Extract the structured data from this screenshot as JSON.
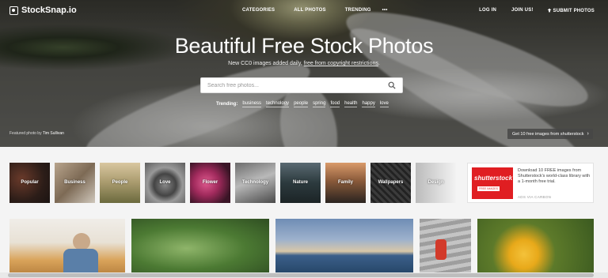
{
  "brand": {
    "name": "StockSnap.io"
  },
  "nav": {
    "center": [
      "CATEGORIES",
      "ALL PHOTOS",
      "TRENDING",
      "•••"
    ],
    "right": [
      "LOG IN",
      "JOIN US!",
      "SUBMIT PHOTOS"
    ]
  },
  "hero": {
    "title": "Beautiful Free Stock Photos",
    "subtitle_pre": "New CC0 images added daily, ",
    "subtitle_link": "free from copyright restrictions",
    "subtitle_post": ".",
    "search_placeholder": "Search free photos...",
    "trending_label": "Trending:",
    "trending": [
      "business",
      "technology",
      "people",
      "spring",
      "food",
      "health",
      "happy",
      "love"
    ],
    "featured_prefix": "Featured photo by ",
    "featured_author": "Tim Sullivan",
    "promo_button": "Get 10 free images from shutterstock"
  },
  "categories": [
    "Popular",
    "Business",
    "People",
    "Love",
    "Flower",
    "Technology",
    "Nature",
    "Family",
    "Wallpapers",
    "Design"
  ],
  "ad": {
    "logo_text": "shutterstock",
    "logo_sub": "FREE IMAGES",
    "text": "Download 10 FREE images from Shutterstock's world-class library with a 1-month free trial.",
    "via": "ADS VIA CARBON"
  },
  "colors": {
    "accent": "#e01e22",
    "hero_overlay": "#000000"
  }
}
